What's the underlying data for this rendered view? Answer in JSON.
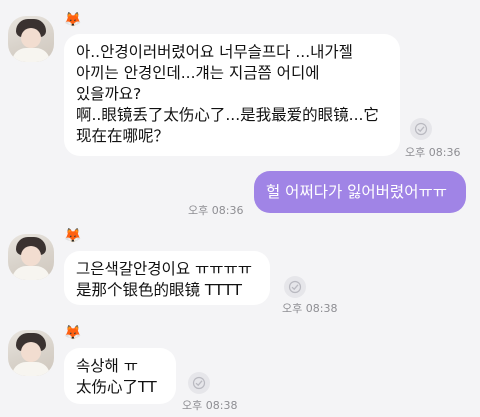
{
  "messages": [
    {
      "sender": "other",
      "badge": "🦊",
      "text": "아..안경이러버렸어요 너무슬프다 ...내가젤\n아끼는 안경인데...걔는 지금쯤 어디에\n있을까요?\n啊..眼镜丢了太伤心了...是我最爱的眼镜...它\n现在在哪呢？",
      "time": "오후 08:36"
    },
    {
      "sender": "me",
      "text": "헐 어쩌다가 잃어버렸어ㅠㅠ",
      "time": "오후 08:36"
    },
    {
      "sender": "other",
      "badge": "🦊",
      "text": "그은색갈안경이요 ㅠㅠㅠㅠ\n是那个银色的眼镜 TTTT",
      "time": "오후 08:38"
    },
    {
      "sender": "other",
      "badge": "🦊",
      "text": "속상해 ㅠ\n太伤心了TT",
      "time": "오후 08:38"
    }
  ],
  "icons": {
    "read_indicator": "read-receipt-icon",
    "profile_badge": "fox-icon"
  },
  "colors": {
    "background": "#f4f4f6",
    "my_bubble": "#a084e6",
    "other_bubble": "#ffffff",
    "time_text": "#8e8e93"
  }
}
